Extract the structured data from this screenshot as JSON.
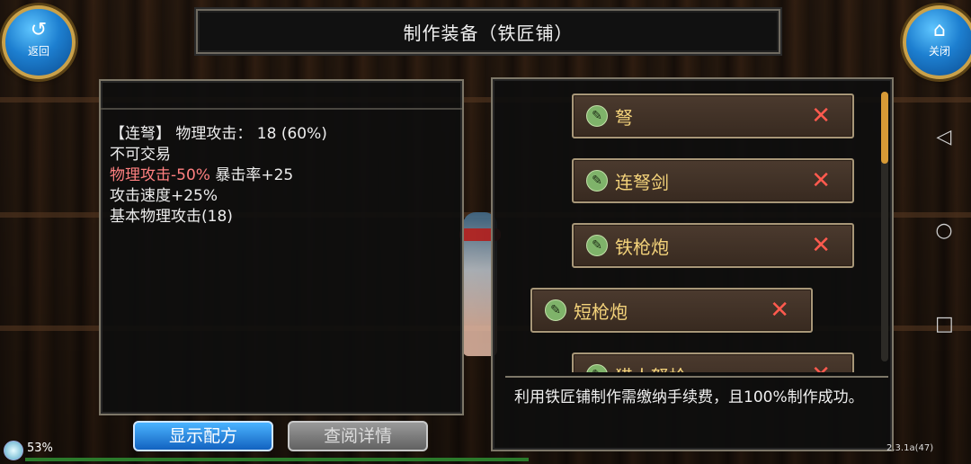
{
  "header": {
    "title": "制作装备（铁匠铺）"
  },
  "nav_buttons": {
    "back_label": "返回",
    "close_label": "关闭"
  },
  "item_desc": {
    "line1": "【连弩】 物理攻击：  18 (60%)",
    "line2": "不可交易",
    "line3_red": "物理攻击-50%",
    "line3_rest": " 暴击率+25",
    "line4": "攻击速度+25%",
    "line5": "基本物理攻击(18)"
  },
  "recipes": [
    {
      "name": "弩"
    },
    {
      "name": "连弩剑"
    },
    {
      "name": "铁枪炮"
    },
    {
      "name": "短枪炮"
    },
    {
      "name": "猎人弩枪"
    }
  ],
  "info": {
    "text": "利用铁匠铺制作需缴纳手续费，且100%制作成功。"
  },
  "buttons": {
    "show_recipe": "显示配方",
    "view_detail": "查阅详情"
  },
  "status": {
    "battery_pct": "53%",
    "version": "2.3.1a(47)"
  },
  "android_nav": {
    "back": "◁",
    "home": "○",
    "recent": "□"
  },
  "colors": {
    "accent_blue": "#1d7fd0",
    "recipe_text": "#f3d27a",
    "remove_red": "#ff5a4e",
    "warning_red": "#ff8080"
  }
}
